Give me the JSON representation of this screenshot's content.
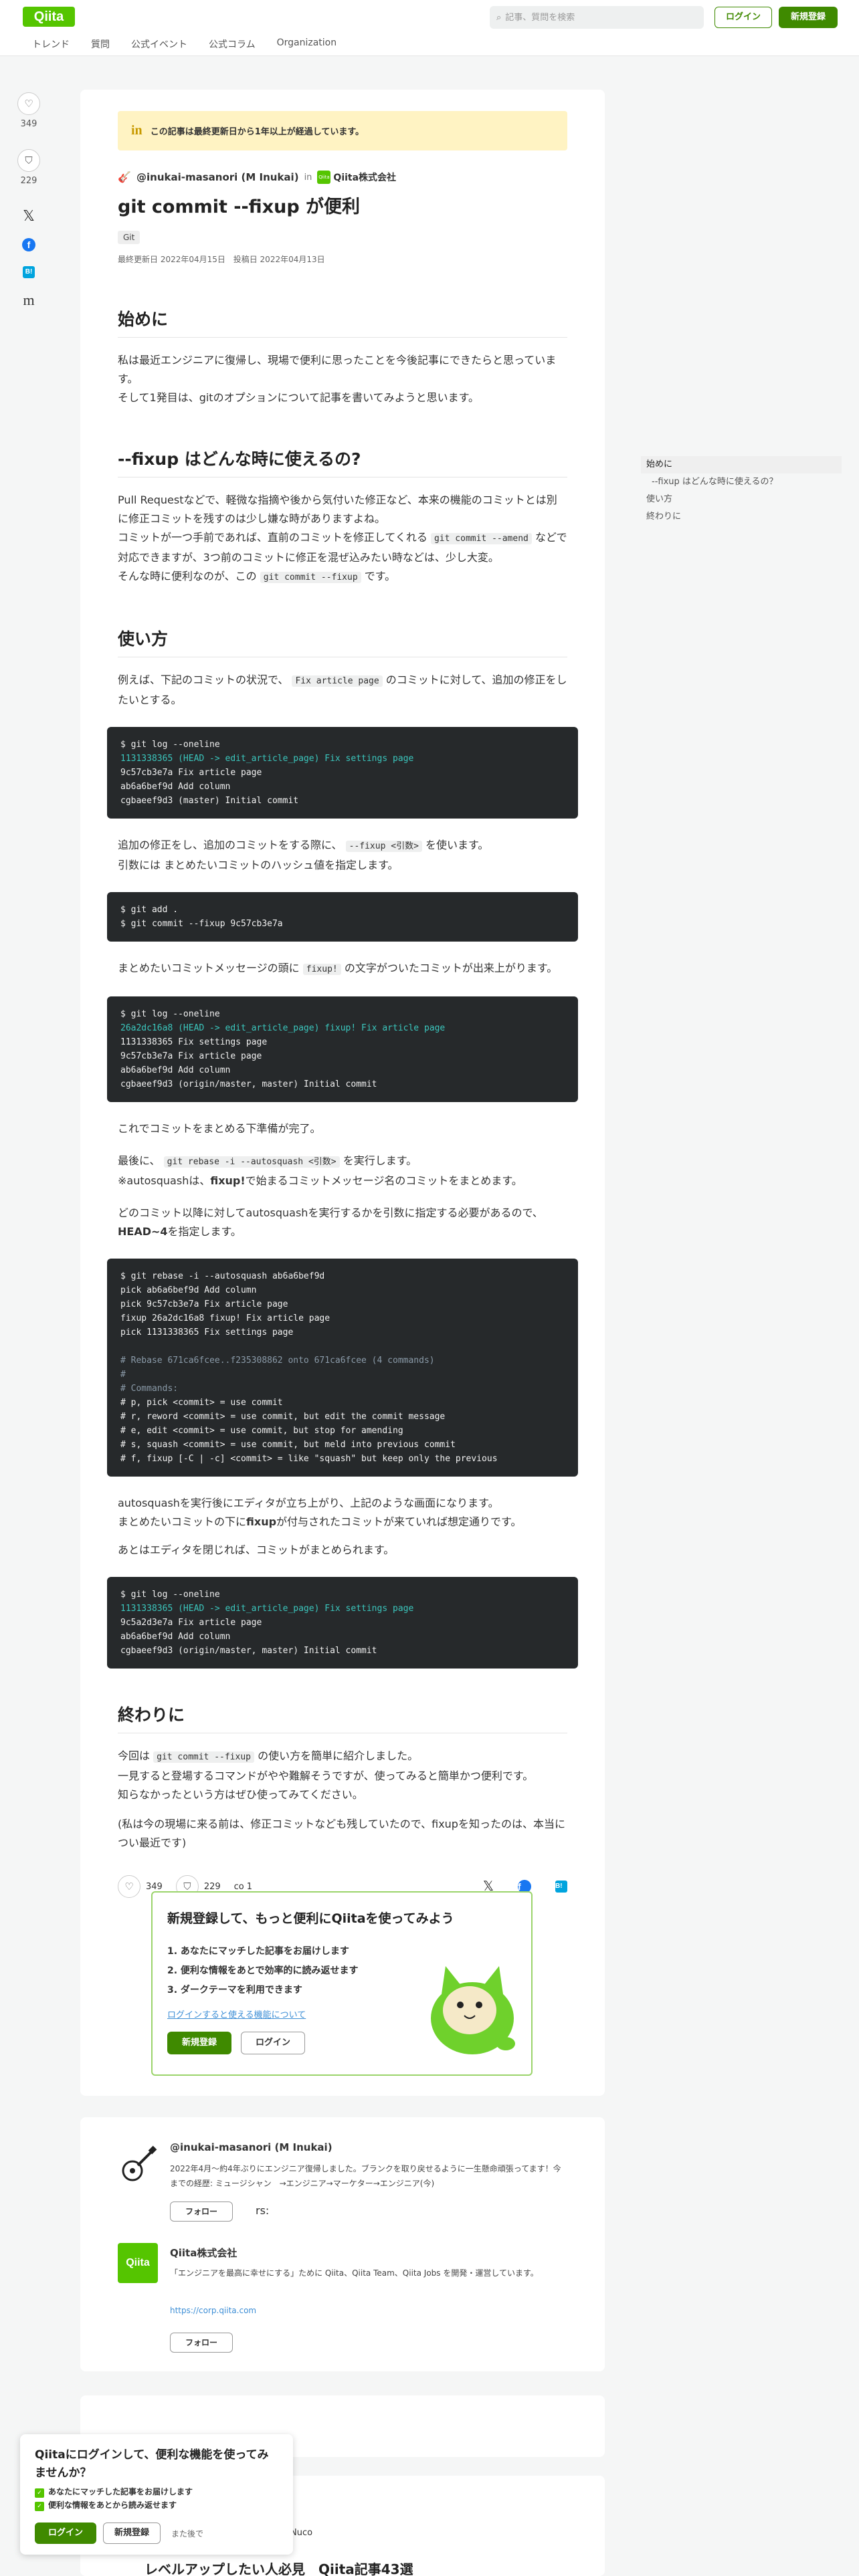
{
  "header": {
    "logo": "Qiita",
    "search_placeholder": "記事、質問を検索",
    "login": "ログイン",
    "signup": "新規登録",
    "nav": [
      "トレンド",
      "質問",
      "公式イベント",
      "公式コラム",
      "Organization"
    ]
  },
  "rail": {
    "likes": "349",
    "stocks": "229"
  },
  "article": {
    "notice": "この記事は最終更新日から1年以上が経過しています。",
    "author": "@inukai-masanori (M Inukai)",
    "in": "in",
    "org": "Qiita株式会社",
    "title": "git commit --fixup が便利",
    "tag": "Git",
    "updated": "最終更新日 2022年04月15日",
    "posted": "投稿日 2022年04月13日",
    "sections": {
      "intro": {
        "heading": "始めに",
        "p1": "私は最近エンジニアに復帰し、現場で便利に思ったことを今後記事にできたらと思っています。",
        "p2": "そして1発目は、gitのオプションについて記事を書いてみようと思います。"
      },
      "when": {
        "heading": "--fixup はどんな時に使えるの?",
        "p1": "Pull Requestなどで、軽微な指摘や後から気付いた修正など、本来の機能のコミットとは別に修正コミットを残すのは少し嫌な時がありますよね。",
        "p2a": "コミットが一つ手前であれば、直前のコミットを修正してくれる",
        "p2code": "git commit --amend",
        "p2b": "などで対応できますが、3つ前のコミットに修正を混ぜ込みたい時などは、少し大変。",
        "p3a": "そんな時に便利なのが、この",
        "p3code": "git commit --fixup",
        "p3b": "です。"
      },
      "howto": {
        "heading": "使い方",
        "p1a": "例えば、下記のコミットの状況で、",
        "p1code": "Fix article page",
        "p1b": "のコミットに対して、追加の修正をしたいとする。",
        "code1": [
          "$ git log --oneline",
          "1131338365 (HEAD -> edit_article_page) Fix settings page",
          "9c57cb3e7a Fix article page",
          "ab6a6bef9d Add column",
          "cgbaeef9d3 (master) Initial commit"
        ],
        "p2a": "追加の修正をし、追加のコミットをする際に、",
        "p2code": "--fixup <引数>",
        "p2b": "を使います。",
        "p3": "引数には まとめたいコミットのハッシュ値を指定します。",
        "code2": [
          "$ git add .",
          "$ git commit --fixup 9c57cb3e7a"
        ],
        "p4a": "まとめたいコミットメッセージの頭に",
        "p4code": "fixup!",
        "p4b": "の文字がついたコミットが出来上がります。",
        "code3": [
          "$ git log --oneline",
          "26a2dc16a8 (HEAD -> edit_article_page) fixup! Fix article page",
          "1131338365 Fix settings page",
          "9c57cb3e7a Fix article page",
          "ab6a6bef9d Add column",
          "cgbaeef9d3 (origin/master, master) Initial commit"
        ],
        "p5": "これでコミットをまとめる下準備が完了。",
        "p6a": "最後に、",
        "p6code": "git rebase -i --autosquash <引数>",
        "p6b": "を実行します。",
        "p7a": "※autosquashは、",
        "p7b": "fixup!",
        "p7c": "で始まるコミットメッセージ名のコミットをまとめます。",
        "p8a": "どのコミット以降に対してautosquashを実行するかを引数に指定する必要があるので、",
        "p8b": "HEAD~4",
        "p8c": "を指定します。",
        "code4": [
          "$ git rebase -i --autosquash ab6a6bef9d",
          "pick ab6a6bef9d Add column",
          "pick 9c57cb3e7a Fix article page",
          "fixup 26a2dc16a8 fixup! Fix article page",
          "pick 1131338365 Fix settings page",
          "",
          "# Rebase 671ca6fcee..f235308862 onto 671ca6fcee (4 commands)",
          "#",
          "# Commands:",
          "# p, pick <commit> = use commit",
          "# r, reword <commit> = use commit, but edit the commit message",
          "# e, edit <commit> = use commit, but stop for amending",
          "# s, squash <commit> = use commit, but meld into previous commit",
          "# f, fixup [-C | -c] <commit> = like \"squash\" but keep only the previous"
        ],
        "p9": "autosquashを実行後にエディタが立ち上がり、上記のような画面になります。",
        "p10a": "まとめたいコミットの下に",
        "p10b": "fixup",
        "p10c": "が付与されたコミットが来ていれば想定通りです。",
        "p11": "あとはエディタを閉じれば、コミットがまとめられます。",
        "code5": [
          "$ git log --oneline",
          "1131338365 (HEAD -> edit_article_page) Fix settings page",
          "9c5a2d3e7a Fix article page",
          "ab6a6bef9d Add column",
          "cgbaeef9d3 (origin/master, master) Initial commit"
        ]
      },
      "end": {
        "heading": "終わりに",
        "p1a": "今回は",
        "p1code": "git commit --fixup",
        "p1b": "の使い方を簡単に紹介しました。",
        "p2": "一見すると登場するコマンドがやや難解そうですが、使ってみると簡単かつ便利です。",
        "p3": "知らなかったという方はぜひ使ってみてください。",
        "p4": "(私は今の現場に来る前は、修正コミットなども残していたので、fixupを知ったのは、本当につい最近です)"
      }
    },
    "actions": {
      "likes": "349",
      "stocks": "229",
      "comments": "1"
    },
    "promo": {
      "title": "新規登録して、もっと便利にQiitaを使ってみよう",
      "items": [
        "1. あなたにマッチした記事をお届けします",
        "2. 便利な情報をあとで効率的に読み返せます",
        "3. ダークテーマを利用できます"
      ],
      "link": "ログインすると使える機能について",
      "signup": "新規登録",
      "login": "ログイン"
    }
  },
  "toc": {
    "items": [
      "始めに",
      "--fixup はどんな時に使えるの？",
      "使い方",
      "終わりに"
    ]
  },
  "author_card": {
    "name": "@inukai-masanori (M Inukai)",
    "bio": "2022年4月～約4年ぶりにエンジニア復帰しました。ブランクを取り戻せるように一生懸命頑張ってます！今までの経歴: ミュージシャン　→エンジニア→マーケター→エンジニア(今)",
    "follow": "フォロー",
    "rs": "rs:",
    "org_logo": "Qiita",
    "org_name": "Qiita株式会社",
    "org_desc": "「エンジニアを最高に幸せにする」ために Qiita、Qiita Team、Qiita Jobs を開発・運営しています。",
    "org_link": "https://corp.qiita.com",
    "org_follow": "フォロー"
  },
  "bottom": {
    "nuco": "Nuco",
    "title": "レベルアップしたい人必見　Qiita記事43選"
  },
  "popup": {
    "title": "Qiitaにログインして、便利な機能を使ってみませんか？",
    "items": [
      "あなたにマッチした記事をお届けします",
      "便利な情報をあとから読み返せます"
    ],
    "login": "ログイン",
    "signup": "新規登録",
    "later": "また後で"
  }
}
